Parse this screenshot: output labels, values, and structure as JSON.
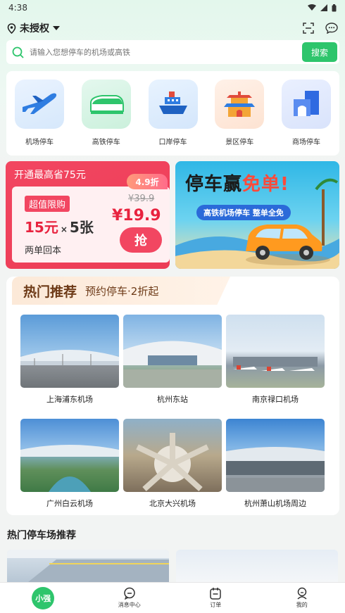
{
  "status_bar": {
    "time": "4:38"
  },
  "header": {
    "location": "未授权"
  },
  "search": {
    "placeholder": "请输入您想停车的机场或高铁",
    "button": "搜索"
  },
  "categories": [
    {
      "label": "机场停车",
      "icon": "airplane-icon"
    },
    {
      "label": "高铁停车",
      "icon": "train-icon"
    },
    {
      "label": "口岸停车",
      "icon": "ship-icon"
    },
    {
      "label": "景区停车",
      "icon": "pavilion-icon"
    },
    {
      "label": "商场停车",
      "icon": "mall-icon"
    }
  ],
  "promo_left": {
    "title": "开通最高省75元",
    "badge": "4.9折",
    "tag": "超值限购",
    "deal_amount": "15元",
    "deal_times": "×",
    "deal_count": "5张",
    "note": "两单回本",
    "old_price": "¥39.9",
    "new_price": "¥19.9",
    "button": "抢"
  },
  "promo_right": {
    "title_part1": "停车赢",
    "title_part2": "免单!",
    "subtitle": "高铁机场停车  整单全免"
  },
  "hot": {
    "title": "热门推荐",
    "subtitle": "预约停车·2折起",
    "destinations": [
      {
        "name": "上海浦东机场"
      },
      {
        "name": "杭州东站"
      },
      {
        "name": "南京禄口机场"
      },
      {
        "name": "广州白云机场"
      },
      {
        "name": "北京大兴机场"
      },
      {
        "name": "杭州萧山机场周边"
      }
    ]
  },
  "parking_section": {
    "title": "热门停车场推荐"
  },
  "bottom_nav": {
    "home": "小强",
    "messages": "消息中心",
    "orders": "订单",
    "mine": "我的"
  },
  "colors": {
    "brand": "#2ec56c",
    "promo_red": "#f24661",
    "hot_brown": "#6d3a17"
  }
}
